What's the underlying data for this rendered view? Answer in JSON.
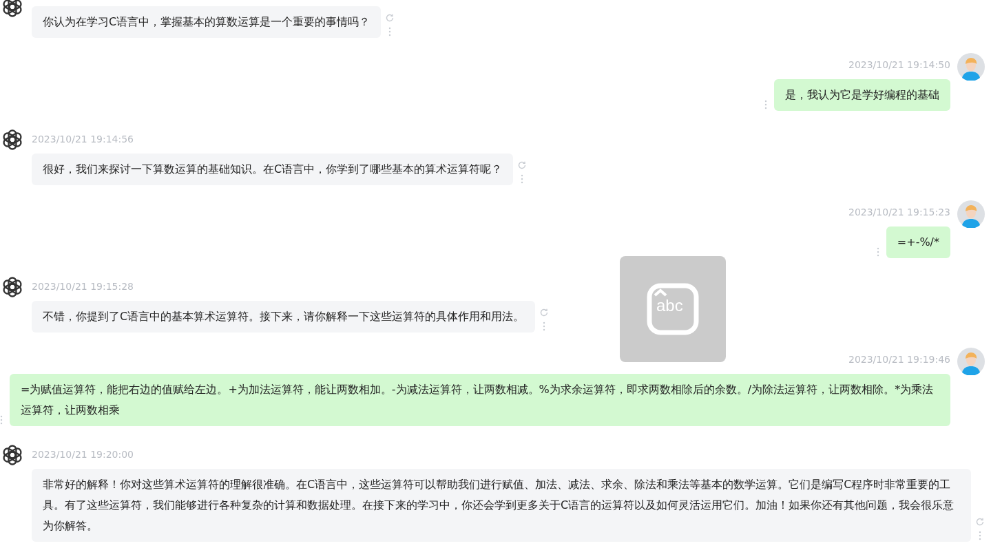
{
  "messages": [
    {
      "kind": "assistant",
      "text": "你认为在学习C语言中，掌握基本的算数运算是一个重要的事情吗？"
    },
    {
      "kind": "user",
      "time": "2023/10/21 19:14:50",
      "text": "是，我认为它是学好编程的基础"
    },
    {
      "kind": "assistant",
      "time": "2023/10/21 19:14:56",
      "text": "很好，我们来探讨一下算数运算的基础知识。在C语言中，你学到了哪些基本的算术运算符呢？"
    },
    {
      "kind": "user",
      "time": "2023/10/21 19:15:23",
      "text": "=+-%/*"
    },
    {
      "kind": "assistant",
      "time": "2023/10/21 19:15:28",
      "text": "不错，你提到了C语言中的基本算术运算符。接下来，请你解释一下这些运算符的具体作用和用法。"
    },
    {
      "kind": "user",
      "time": "2023/10/21 19:19:46",
      "text": "=为赋值运算符，能把右边的值赋给左边。+为加法运算符，能让两数相加。-为减法运算符，让两数相减。%为求余运算符，即求两数相除后的余数。/为除法运算符，让两数相除。*为乘法运算符，让两数相乘"
    },
    {
      "kind": "assistant",
      "time": "2023/10/21 19:20:00",
      "text": "非常好的解释！你对这些算术运算符的理解很准确。在C语言中，这些运算符可以帮助我们进行赋值、加法、减法、求余、除法和乘法等基本的数学运算。它们是编写C程序时非常重要的工具。有了这些运算符，我们能够进行各种复杂的计算和数据处理。在接下来的学习中，你还会学到更多关于C语言的运算符以及如何灵活运用它们。加油！如果你还有其他问题，我会很乐意为你解答。"
    }
  ],
  "input_indicator": {
    "label": "abc"
  }
}
